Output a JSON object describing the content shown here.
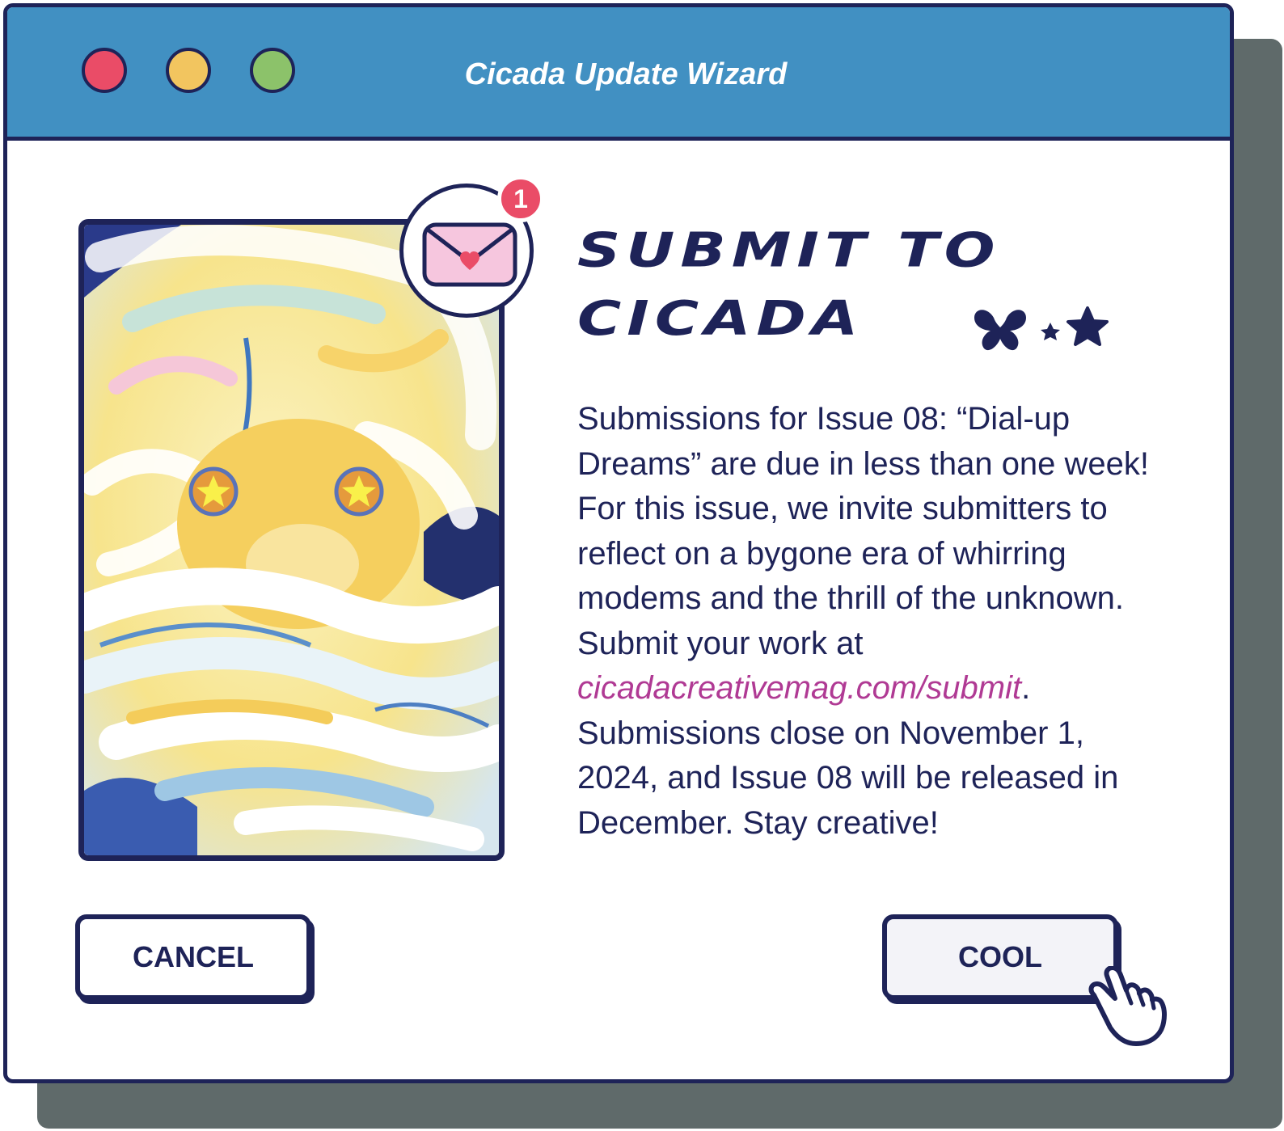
{
  "window": {
    "title": "Cicada Update Wizard",
    "controls": [
      "close",
      "minimize",
      "maximize"
    ]
  },
  "notification": {
    "count": "1",
    "icon": "envelope-heart-icon"
  },
  "heading": {
    "line1": "SUBMIT TO",
    "line2": "CICADA",
    "decoration": "butterfly-star-icons"
  },
  "body": {
    "text_before_link": "Submissions for Issue 08: “Dial-up Dreams” are due in less than one week! For this issue, we invite submitters to reflect on a bygone era of whirring modems and the thrill of the unknown. Submit your work at ",
    "link": "cicadacreativemag.com/submit",
    "text_after_link": ". Submissions close on November 1, 2024, and Issue 08 will be released in December. Stay creative!"
  },
  "buttons": {
    "cancel": "CANCEL",
    "cool": "COOL"
  },
  "colors": {
    "titlebar": "#4190c2",
    "navy": "#1e2358",
    "close": "#ea4c67",
    "minimize": "#f2c55f",
    "maximize": "#8cc26a",
    "link": "#b03a94",
    "shadow": "#5f6a6a"
  }
}
